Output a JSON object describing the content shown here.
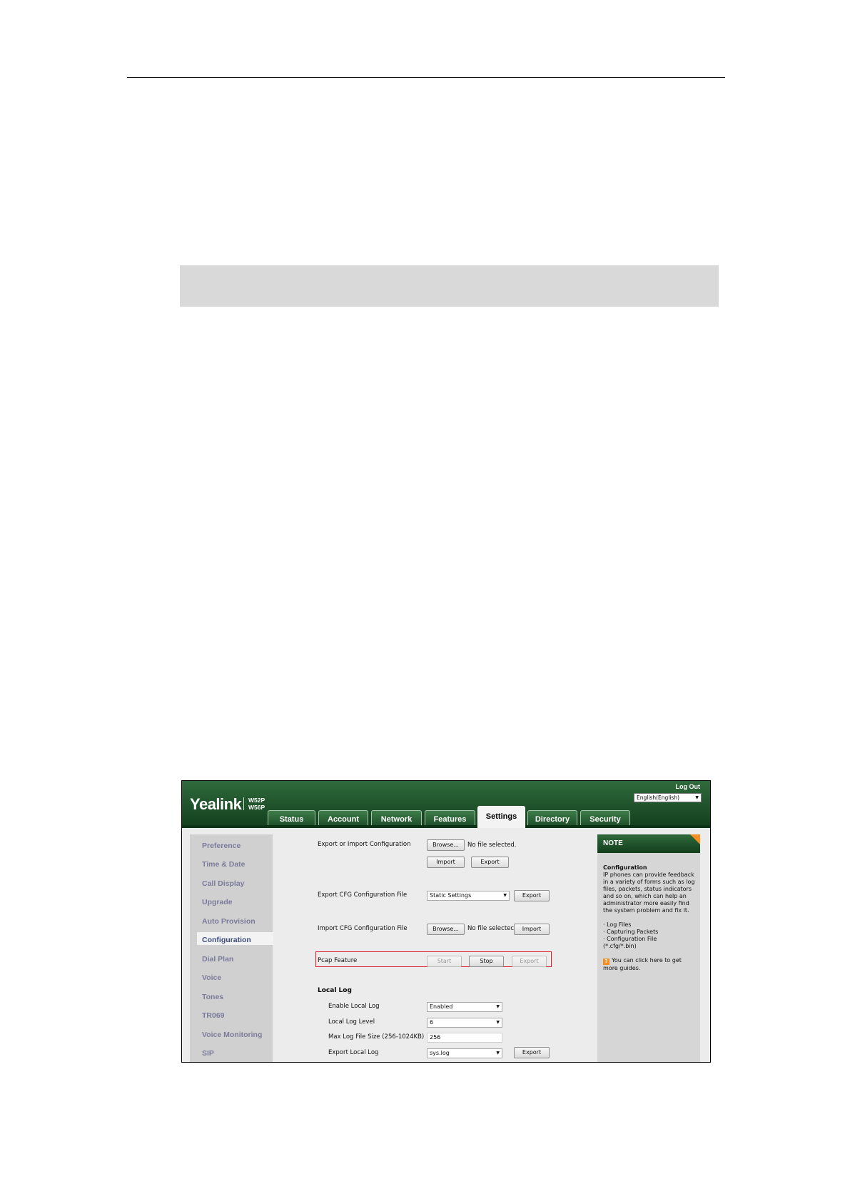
{
  "screenshot": {
    "header": {
      "logo": "Yealink",
      "model_line1": "W52P",
      "model_line2": "W56P",
      "logout": "Log Out",
      "language": "English(English)"
    },
    "tabs": [
      {
        "label": "Status"
      },
      {
        "label": "Account"
      },
      {
        "label": "Network"
      },
      {
        "label": "Features"
      },
      {
        "label": "Settings",
        "active": true
      },
      {
        "label": "Directory"
      },
      {
        "label": "Security"
      }
    ],
    "sidebar": [
      {
        "label": "Preference"
      },
      {
        "label": "Time & Date"
      },
      {
        "label": "Call Display"
      },
      {
        "label": "Upgrade"
      },
      {
        "label": "Auto Provision"
      },
      {
        "label": "Configuration",
        "active": true
      },
      {
        "label": "Dial Plan"
      },
      {
        "label": "Voice"
      },
      {
        "label": "Tones"
      },
      {
        "label": "TR069"
      },
      {
        "label": "Voice Monitoring"
      },
      {
        "label": "SIP"
      }
    ],
    "main": {
      "export_import_label": "Export or Import Configuration",
      "browse": "Browse...",
      "no_file": "No file selected.",
      "import": "Import",
      "export": "Export",
      "export_cfg_label": "Export CFG Configuration File",
      "export_cfg_select": "Static Settings",
      "import_cfg_label": "Import CFG Configuration File",
      "no_file_truncated": "No file selectec",
      "pcap_label": "Pcap Feature",
      "pcap_start": "Start",
      "pcap_stop": "Stop",
      "pcap_export": "Export",
      "local_log_title": "Local Log",
      "enable_local_log_label": "Enable Local Log",
      "enable_local_log_value": "Enabled",
      "local_log_level_label": "Local Log Level",
      "local_log_level_value": "6",
      "max_log_size_label": "Max Log File Size (256-1024KB)",
      "max_log_size_value": "256",
      "export_local_log_label": "Export Local Log",
      "export_local_log_value": "sys.log"
    },
    "note": {
      "header": "NOTE",
      "title": "Configuration",
      "body": "IP phones can provide feedback in a variety of forms such as log files, packets, status indicators and so on, which can help an administrator more easily find the system problem and fix it.",
      "bullet1": "· Log Files",
      "bullet2": "· Capturing Packets",
      "bullet3": "· Configuration File",
      "bullet3_cont": "(*.cfg/*.bin)",
      "guide": "You can click here to get more guides."
    },
    "colors": {
      "header_green": "#1f5229",
      "pcap_highlight": "#d9202a",
      "note_fold": "#f29022"
    }
  }
}
